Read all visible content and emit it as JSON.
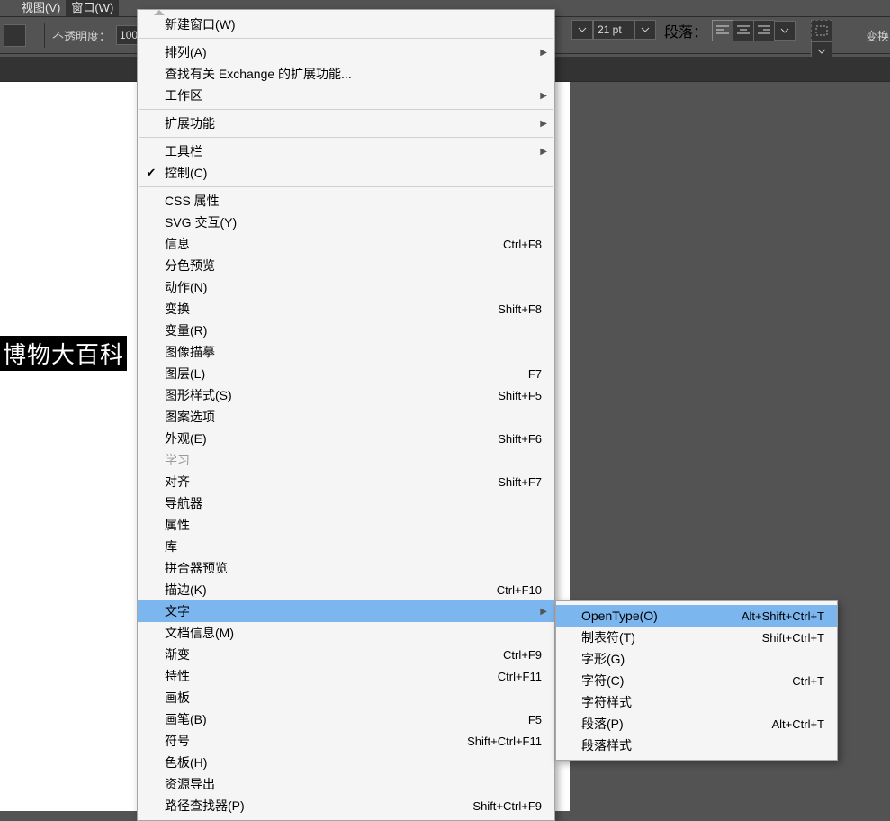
{
  "menubar": {
    "view": "视图(V)",
    "window": "窗口(W)"
  },
  "toolbar": {
    "opacity_label": "不透明度：",
    "opacity_value": "100",
    "size_value": "21 pt",
    "paragraph_label": "段落：",
    "transform_label": "变换"
  },
  "canvas": {
    "text": "博物大百科"
  },
  "menu": {
    "items": [
      {
        "t": "item",
        "label": "新建窗口(W)"
      },
      {
        "t": "sep"
      },
      {
        "t": "item",
        "label": "排列(A)",
        "sub": true
      },
      {
        "t": "item",
        "label": "查找有关 Exchange 的扩展功能..."
      },
      {
        "t": "item",
        "label": "工作区",
        "sub": true
      },
      {
        "t": "sep"
      },
      {
        "t": "item",
        "label": "扩展功能",
        "sub": true
      },
      {
        "t": "sep"
      },
      {
        "t": "item",
        "label": "工具栏",
        "sub": true
      },
      {
        "t": "item",
        "label": "控制(C)",
        "checked": true
      },
      {
        "t": "sep"
      },
      {
        "t": "item",
        "label": "CSS 属性"
      },
      {
        "t": "item",
        "label": "SVG 交互(Y)"
      },
      {
        "t": "item",
        "label": "信息",
        "shortcut": "Ctrl+F8"
      },
      {
        "t": "item",
        "label": "分色预览"
      },
      {
        "t": "item",
        "label": "动作(N)"
      },
      {
        "t": "item",
        "label": "变换",
        "shortcut": "Shift+F8"
      },
      {
        "t": "item",
        "label": "变量(R)"
      },
      {
        "t": "item",
        "label": "图像描摹"
      },
      {
        "t": "item",
        "label": "图层(L)",
        "shortcut": "F7"
      },
      {
        "t": "item",
        "label": "图形样式(S)",
        "shortcut": "Shift+F5"
      },
      {
        "t": "item",
        "label": "图案选项"
      },
      {
        "t": "item",
        "label": "外观(E)",
        "shortcut": "Shift+F6"
      },
      {
        "t": "item",
        "label": "学习",
        "disabled": true
      },
      {
        "t": "item",
        "label": "对齐",
        "shortcut": "Shift+F7"
      },
      {
        "t": "item",
        "label": "导航器"
      },
      {
        "t": "item",
        "label": "属性"
      },
      {
        "t": "item",
        "label": "库"
      },
      {
        "t": "item",
        "label": "拼合器预览"
      },
      {
        "t": "item",
        "label": "描边(K)",
        "shortcut": "Ctrl+F10"
      },
      {
        "t": "item",
        "label": "文字",
        "sub": true,
        "hl": true
      },
      {
        "t": "item",
        "label": "文档信息(M)"
      },
      {
        "t": "item",
        "label": "渐变",
        "shortcut": "Ctrl+F9"
      },
      {
        "t": "item",
        "label": "特性",
        "shortcut": "Ctrl+F11"
      },
      {
        "t": "item",
        "label": "画板"
      },
      {
        "t": "item",
        "label": "画笔(B)",
        "shortcut": "F5"
      },
      {
        "t": "item",
        "label": "符号",
        "shortcut": "Shift+Ctrl+F11"
      },
      {
        "t": "item",
        "label": "色板(H)"
      },
      {
        "t": "item",
        "label": "资源导出"
      },
      {
        "t": "item",
        "label": "路径查找器(P)",
        "shortcut": "Shift+Ctrl+F9"
      }
    ]
  },
  "submenu": {
    "items": [
      {
        "label": "OpenType(O)",
        "shortcut": "Alt+Shift+Ctrl+T",
        "hl": true
      },
      {
        "label": "制表符(T)",
        "shortcut": "Shift+Ctrl+T"
      },
      {
        "label": "字形(G)"
      },
      {
        "label": "字符(C)",
        "shortcut": "Ctrl+T"
      },
      {
        "label": "字符样式"
      },
      {
        "label": "段落(P)",
        "shortcut": "Alt+Ctrl+T"
      },
      {
        "label": "段落样式"
      }
    ]
  }
}
